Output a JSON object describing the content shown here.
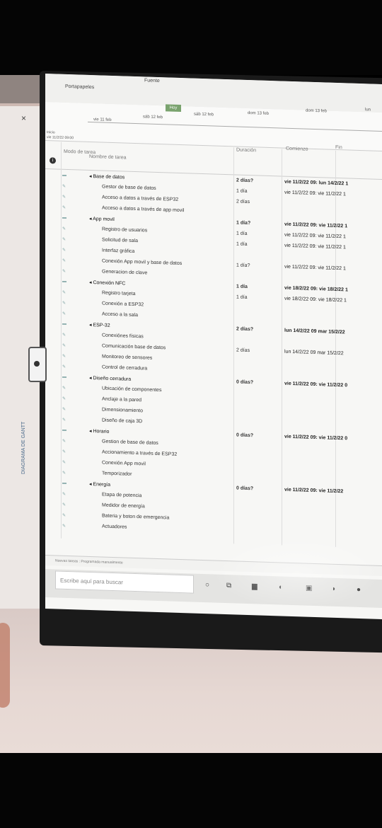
{
  "ribbon": {
    "clipboard": "Portapapeles",
    "font": "Fuente"
  },
  "timeline": {
    "today": "Hoy",
    "start_label": "Inicio",
    "start_value": "vie 11/2/22 09:00",
    "dates": [
      "vie 11 feb",
      "sáb 12 feb",
      "sáb 12 feb",
      "dom 13 feb",
      "dom 13 feb",
      "lun"
    ]
  },
  "header": {
    "mode": "Modo de tarea",
    "name": "Nombre de tarea",
    "duration": "Duración",
    "start": "Comienzo",
    "end": "Fin"
  },
  "tasks": [
    {
      "name": "Base de datos",
      "level": 0,
      "summary": true,
      "dur": "2 días?",
      "start": "vie 11/2/22 09: lun 14/2/22 1"
    },
    {
      "name": "Gestor de base de datos",
      "level": 1,
      "summary": false,
      "dur": "1 día",
      "start": "vie 11/2/22 09: vie 11/2/22 1"
    },
    {
      "name": "Acceso a datos a través de ESP32",
      "level": 1,
      "summary": false,
      "dur": "2 días",
      "start": ""
    },
    {
      "name": "Acceso a datos a través de app movil",
      "level": 1,
      "summary": false,
      "dur": "",
      "start": ""
    },
    {
      "name": "App movil",
      "level": 0,
      "summary": true,
      "dur": "1 día?",
      "start": "vie 11/2/22 09: vie 11/2/22 1"
    },
    {
      "name": "Registro de usuarios",
      "level": 1,
      "summary": false,
      "dur": "1 día",
      "start": "vie 11/2/22 09: vie 11/2/22 1"
    },
    {
      "name": "Solicitud de sala",
      "level": 1,
      "summary": false,
      "dur": "1 día",
      "start": "vie 11/2/22 09: vie 11/2/22 1"
    },
    {
      "name": "Interfaz gráfica",
      "level": 1,
      "summary": false,
      "dur": "",
      "start": ""
    },
    {
      "name": "Conexión App movil y base de datos",
      "level": 1,
      "summary": false,
      "dur": "1 día?",
      "start": "vie 11/2/22 09: vie 11/2/22 1"
    },
    {
      "name": "Generacion de clave",
      "level": 1,
      "summary": false,
      "dur": "",
      "start": ""
    },
    {
      "name": "Conexión NFC",
      "level": 0,
      "summary": true,
      "dur": "1 día",
      "start": "vie 18/2/22 09: vie 18/2/22 1"
    },
    {
      "name": "Registro tarjeta",
      "level": 1,
      "summary": false,
      "dur": "1 día",
      "start": "vie 18/2/22 09: vie 18/2/22 1"
    },
    {
      "name": "Conexión a ESP32",
      "level": 1,
      "summary": false,
      "dur": "",
      "start": ""
    },
    {
      "name": "Acceso a la sala",
      "level": 1,
      "summary": false,
      "dur": "",
      "start": ""
    },
    {
      "name": "ESP-32",
      "level": 0,
      "summary": true,
      "dur": "2 días?",
      "start": "lun 14/2/22 09 mar 15/2/22"
    },
    {
      "name": "Conexiónes físicas",
      "level": 1,
      "summary": false,
      "dur": "",
      "start": ""
    },
    {
      "name": "Comunicación base de datos",
      "level": 1,
      "summary": false,
      "dur": "2 días",
      "start": "lun 14/2/22 09 mar 15/2/22"
    },
    {
      "name": "Monitoreo de sensores",
      "level": 1,
      "summary": false,
      "dur": "",
      "start": ""
    },
    {
      "name": "Control de cerradura",
      "level": 1,
      "summary": false,
      "dur": "",
      "start": ""
    },
    {
      "name": "Diseño cerradura",
      "level": 0,
      "summary": true,
      "dur": "0 días?",
      "start": "vie 11/2/22 09: vie 11/2/22 0"
    },
    {
      "name": "Ubicación de componentes",
      "level": 1,
      "summary": false,
      "dur": "",
      "start": ""
    },
    {
      "name": "Anclaje a la pared",
      "level": 1,
      "summary": false,
      "dur": "",
      "start": ""
    },
    {
      "name": "Dimensionamiento",
      "level": 1,
      "summary": false,
      "dur": "",
      "start": ""
    },
    {
      "name": "Diseño de caja 3D",
      "level": 1,
      "summary": false,
      "dur": "",
      "start": ""
    },
    {
      "name": "Horario",
      "level": 0,
      "summary": true,
      "dur": "0 días?",
      "start": "vie 11/2/22 09: vie 11/2/22 0"
    },
    {
      "name": "Gestion de base de datos",
      "level": 1,
      "summary": false,
      "dur": "",
      "start": ""
    },
    {
      "name": "Accionamiento a través de ESP32",
      "level": 1,
      "summary": false,
      "dur": "",
      "start": ""
    },
    {
      "name": "Conexión App movil",
      "level": 1,
      "summary": false,
      "dur": "",
      "start": ""
    },
    {
      "name": "Temporizador",
      "level": 1,
      "summary": false,
      "dur": "",
      "start": ""
    },
    {
      "name": "Energía",
      "level": 0,
      "summary": true,
      "dur": "0 días?",
      "start": "vie 11/2/22 09: vie 11/2/22"
    },
    {
      "name": "Etapa de potencia",
      "level": 1,
      "summary": false,
      "dur": "",
      "start": ""
    },
    {
      "name": "Medidor de energía",
      "level": 1,
      "summary": false,
      "dur": "",
      "start": ""
    },
    {
      "name": "Bateria y boton de emergencia",
      "level": 1,
      "summary": false,
      "dur": "",
      "start": ""
    },
    {
      "name": "Actuadores",
      "level": 1,
      "summary": false,
      "dur": "",
      "start": ""
    }
  ],
  "side": {
    "view_label": "DIAGRAMA DE GANTT",
    "close": "×"
  },
  "status": {
    "text": "Nuevas tareas : Programada manualmente"
  },
  "taskbar": {
    "search_placeholder": "Escribe aquí para buscar"
  }
}
